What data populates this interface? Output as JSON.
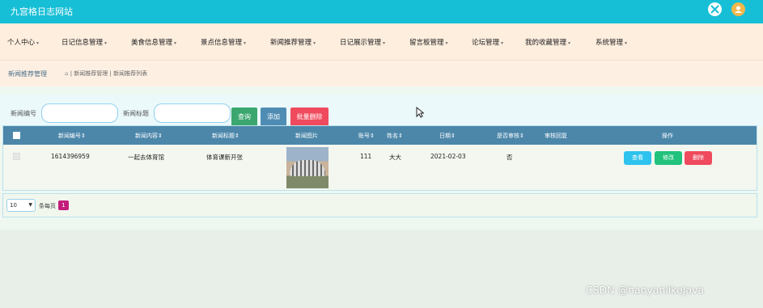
{
  "app_title": "九宫格日志网站",
  "topbar_icons": [
    "fullscreen-icon",
    "user-icon"
  ],
  "menu": [
    {
      "label": "个人中心"
    },
    {
      "label": "日记信息管理"
    },
    {
      "label": "美食信息管理"
    },
    {
      "label": "景点信息管理"
    },
    {
      "label": "新闻推荐管理"
    },
    {
      "label": "日记展示管理"
    },
    {
      "label": "留言板管理"
    },
    {
      "label": "论坛管理"
    },
    {
      "label": "我的收藏管理"
    },
    {
      "label": "系统管理"
    }
  ],
  "breadcrumb": {
    "title": "新闻推荐管理",
    "path": "| 新闻推荐管理 | 新闻推荐列表"
  },
  "search": {
    "field1_label": "新闻编号",
    "field1_value": "",
    "field2_label": "新闻标题",
    "field2_value": "",
    "query_label": "查询",
    "add_label": "添加",
    "batch_delete_label": "批量删除"
  },
  "table": {
    "columns": [
      "新闻编号",
      "新闻内容",
      "新闻标题",
      "新闻图片",
      "账号",
      "姓名",
      "日期",
      "是否审核",
      "审核回复",
      "操作"
    ],
    "rows": [
      {
        "news_id": "1614396959",
        "content": "一起去体育馆",
        "title": "体育课新开张",
        "account": "111",
        "name": "大大",
        "date": "2021-02-03",
        "reviewed": "否",
        "reply": "",
        "actions": {
          "view": "查看",
          "edit": "修改",
          "delete": "删除"
        }
      }
    ]
  },
  "pagination": {
    "page_size": "10",
    "page_size_label": "条每页",
    "current_page": "1"
  },
  "watermark": "CSDN @haoyanlikeJava",
  "colors": {
    "topbar": "#17bfd6",
    "menubar": "#fdeede",
    "table_header": "#4c87aa",
    "danger": "#ef4a5d",
    "success": "#20c27c",
    "info": "#2ec2ee",
    "page_active": "#c31d7c"
  }
}
